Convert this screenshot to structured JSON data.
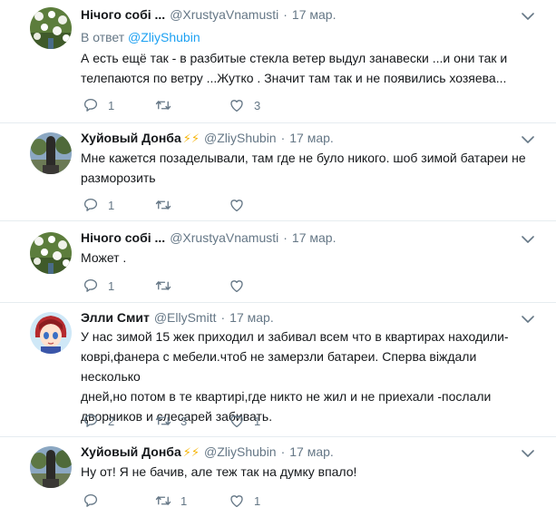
{
  "colors": {
    "link": "#1da1f2",
    "muted": "#657786",
    "text": "#14171a",
    "separator": "#e6ecf0",
    "bolt": "#f5b50a"
  },
  "tweets": [
    {
      "name": "Нічого собі ...",
      "handle": "@XrustyaVnamusti",
      "dot": "·",
      "time": "17 мар.",
      "reply_prefix": "В ответ",
      "reply_target": "@ZliyShubin",
      "lines": [
        "А есть ещё так - в разбитые стекла ветер выдул занавески ...и они так и",
        "телепаются по ветру ...Жутко . Значит там так и не появились хозяева..."
      ],
      "replies": "1",
      "retweets": "",
      "likes": "3"
    },
    {
      "name": "Хуйовый Донба",
      "bolts": "⚡⚡",
      "handle": "@ZliyShubin",
      "dot": "·",
      "time": "17 мар.",
      "lines": [
        "Мне кажется позаделывали, там где не було никого. шоб зимой батареи не",
        "разморозить"
      ],
      "replies": "1",
      "retweets": "",
      "likes": ""
    },
    {
      "name": "Нічого собі ...",
      "handle": "@XrustyaVnamusti",
      "dot": "·",
      "time": "17 мар.",
      "lines": [
        "Может ."
      ],
      "replies": "1",
      "retweets": "",
      "likes": ""
    },
    {
      "name": "Элли Смит",
      "handle": "@EllySmitt",
      "dot": "·",
      "time": "17 мар.",
      "lines": [
        "У нас зимой 15 жек приходил и забивал всем что в квартирах находили-",
        "коврі,фанера с мебели.чтоб не замерзли батареи. Сперва віждали несколько",
        "дней,но потом в те квартирі,где никто не жил и не приехали -послали",
        "дворников и слесарей забивать."
      ],
      "replies": "2",
      "retweets": "3",
      "likes": "1"
    },
    {
      "name": "Хуйовый Донба",
      "bolts": "⚡⚡",
      "handle": "@ZliyShubin",
      "dot": "·",
      "time": "17 мар.",
      "lines": [
        "Ну от! Я не бачив, але теж так на думку впало!"
      ],
      "replies": "",
      "retweets": "1",
      "likes": "1"
    }
  ]
}
